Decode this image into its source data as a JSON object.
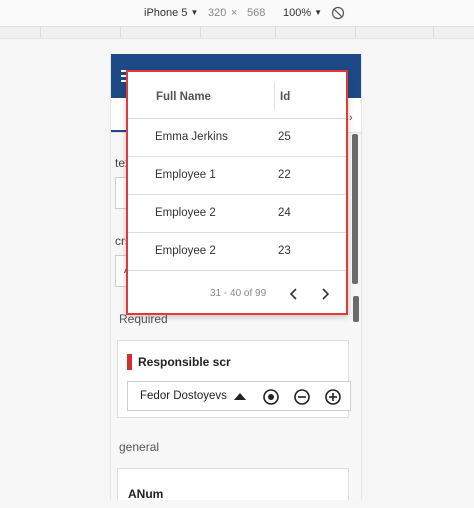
{
  "devtools": {
    "device": "iPhone 5",
    "width": "320",
    "separator": "×",
    "height": "568",
    "zoom": "100%"
  },
  "form": {
    "field_label_1": "tex",
    "field_label_2": "crs",
    "field_value_2": "A",
    "section_required": "Required",
    "responsible_title": "Responsible scr",
    "responsible_value": "Fedor Dostoyevs",
    "section_general": "general",
    "anum_title": "ANum"
  },
  "lookup": {
    "columns": [
      "Full Name",
      "Id"
    ],
    "rows": [
      {
        "name": "Emma Jerkins",
        "id": "25"
      },
      {
        "name": "Employee 1",
        "id": "22"
      },
      {
        "name": "Employee 2",
        "id": "24"
      },
      {
        "name": "Employee 2",
        "id": "23"
      }
    ],
    "pager": "31 - 40 of 99"
  },
  "colors": {
    "appbar": "#1d4a86",
    "required_marker": "#d32f2f",
    "overlay_border": "#e53935"
  }
}
